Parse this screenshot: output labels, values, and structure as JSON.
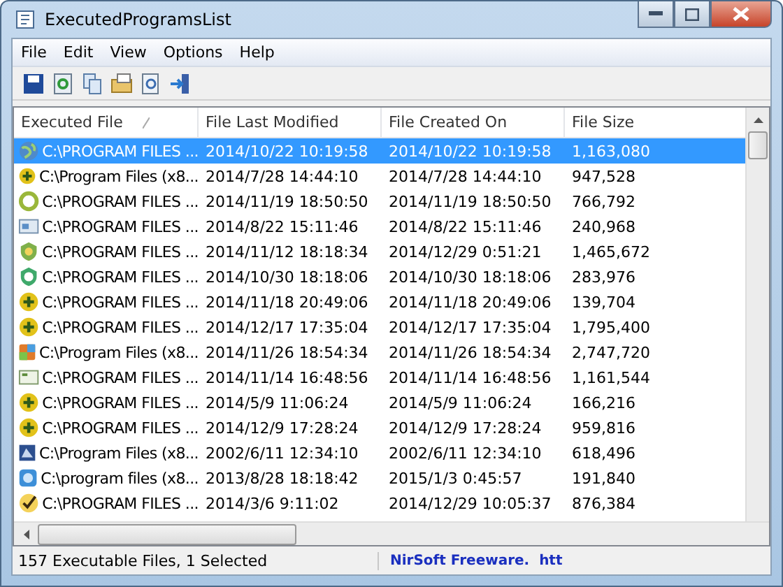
{
  "window": {
    "title": "ExecutedProgramsList"
  },
  "menu": [
    "File",
    "Edit",
    "View",
    "Options",
    "Help"
  ],
  "table": {
    "columns": [
      {
        "label": "Executed File",
        "sorted": true
      },
      {
        "label": "File Last Modified",
        "sorted": false
      },
      {
        "label": "File Created On",
        "sorted": false
      },
      {
        "label": "File Size",
        "sorted": false
      }
    ],
    "rows": [
      {
        "cells": [
          "C:\\PROGRAM FILES ...",
          "2014/10/22 10:19:58",
          "2014/10/22 10:19:58",
          "1,163,080"
        ],
        "selected": true
      },
      {
        "cells": [
          "C:\\Program Files (x8...",
          "2014/7/28 14:44:10",
          "2014/7/28 14:44:10",
          "947,528"
        ],
        "selected": false
      },
      {
        "cells": [
          "C:\\PROGRAM FILES ...",
          "2014/11/19 18:50:50",
          "2014/11/19 18:50:50",
          "766,792"
        ],
        "selected": false
      },
      {
        "cells": [
          "C:\\PROGRAM FILES ...",
          "2014/8/22 15:11:46",
          "2014/8/22 15:11:46",
          "240,968"
        ],
        "selected": false
      },
      {
        "cells": [
          "C:\\PROGRAM FILES ...",
          "2014/11/12 18:18:34",
          "2014/12/29 0:51:21",
          "1,465,672"
        ],
        "selected": false
      },
      {
        "cells": [
          "C:\\PROGRAM FILES ...",
          "2014/10/30 18:18:06",
          "2014/10/30 18:18:06",
          "283,976"
        ],
        "selected": false
      },
      {
        "cells": [
          "C:\\PROGRAM FILES ...",
          "2014/11/18 20:49:06",
          "2014/11/18 20:49:06",
          "139,704"
        ],
        "selected": false
      },
      {
        "cells": [
          "C:\\PROGRAM FILES ...",
          "2014/12/17 17:35:04",
          "2014/12/17 17:35:04",
          "1,795,400"
        ],
        "selected": false
      },
      {
        "cells": [
          "C:\\Program Files (x8...",
          "2014/11/26 18:54:34",
          "2014/11/26 18:54:34",
          "2,747,720"
        ],
        "selected": false
      },
      {
        "cells": [
          "C:\\PROGRAM FILES ...",
          "2014/11/14 16:48:56",
          "2014/11/14 16:48:56",
          "1,161,544"
        ],
        "selected": false
      },
      {
        "cells": [
          "C:\\PROGRAM FILES ...",
          "2014/5/9 11:06:24",
          "2014/5/9 11:06:24",
          "166,216"
        ],
        "selected": false
      },
      {
        "cells": [
          "C:\\PROGRAM FILES ...",
          "2014/12/9 17:28:24",
          "2014/12/9 17:28:24",
          "959,816"
        ],
        "selected": false
      },
      {
        "cells": [
          "C:\\Program Files (x8...",
          "2002/6/11 12:34:10",
          "2002/6/11 12:34:10",
          "618,496"
        ],
        "selected": false
      },
      {
        "cells": [
          "C:\\program files (x8...",
          "2013/8/28 18:18:42",
          "2015/1/3 0:45:57",
          "191,840"
        ],
        "selected": false
      },
      {
        "cells": [
          "C:\\PROGRAM FILES ...",
          "2014/3/6 9:11:02",
          "2014/12/29 10:05:37",
          "876,384"
        ],
        "selected": false
      }
    ]
  },
  "status_bar": {
    "count": "157 Executable Files, 1 Selected",
    "credit": "NirSoft Freeware.  htt"
  }
}
